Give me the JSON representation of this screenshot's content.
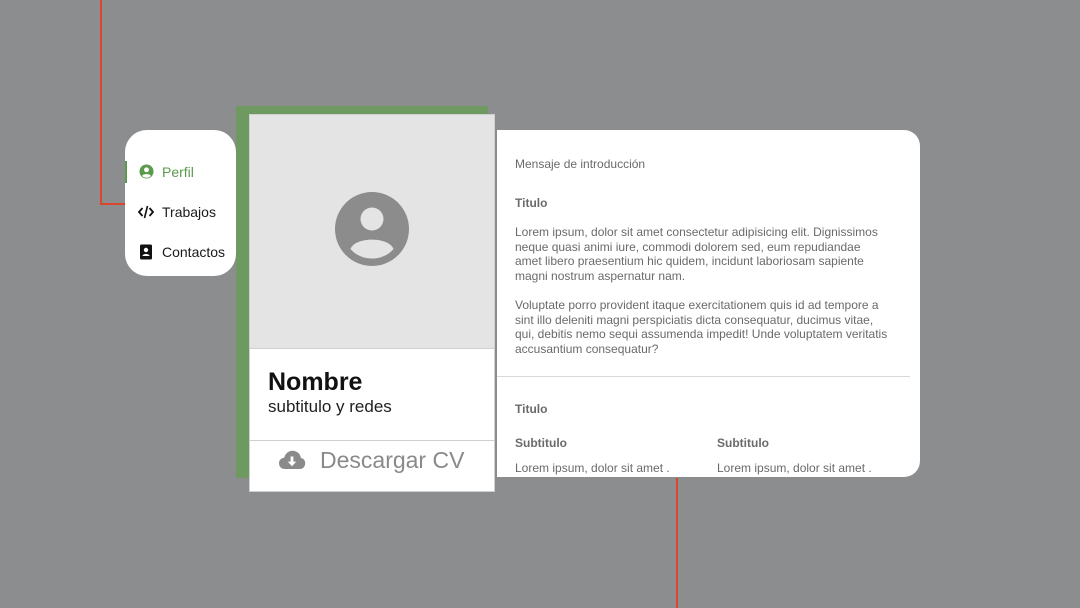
{
  "colors": {
    "background": "#8c8d8f",
    "accent": "#5b9a4e",
    "green_accent": "#6e9a62",
    "guide_line": "#d9452f"
  },
  "nav": {
    "items": [
      {
        "label": "Perfil",
        "icon": "user-circle-icon",
        "active": true
      },
      {
        "label": "Trabajos",
        "icon": "code-icon",
        "active": false
      },
      {
        "label": "Contactos",
        "icon": "contact-book-icon",
        "active": false
      }
    ]
  },
  "profile": {
    "avatar_icon": "user-avatar-icon",
    "name": "Nombre",
    "subtitle": "subtitulo y redes",
    "download_label": "Descargar CV",
    "download_icon": "cloud-download-icon"
  },
  "content": {
    "intro": "Mensaje de introducción",
    "section1": {
      "title": "Titulo",
      "paragraphs": [
        "Lorem ipsum, dolor sit amet consectetur adipisicing elit. Dignissimos neque quasi animi iure, commodi dolorem sed, eum repudiandae amet libero praesentium hic quidem, incidunt laboriosam sapiente magni nostrum aspernatur nam.",
        "Voluptate porro provident itaque exercitationem quis id ad tempore a sint illo deleniti magni perspiciatis dicta consequatur, ducimus vitae, qui, debitis nemo sequi assumenda impedit! Unde voluptatem veritatis accusantium consequatur?"
      ]
    },
    "section2": {
      "title": "Titulo",
      "columns": [
        {
          "subtitle": "Subtitulo",
          "text": "Lorem ipsum, dolor sit amet ."
        },
        {
          "subtitle": "Subtitulo",
          "text": "Lorem ipsum, dolor sit amet ."
        }
      ]
    }
  }
}
